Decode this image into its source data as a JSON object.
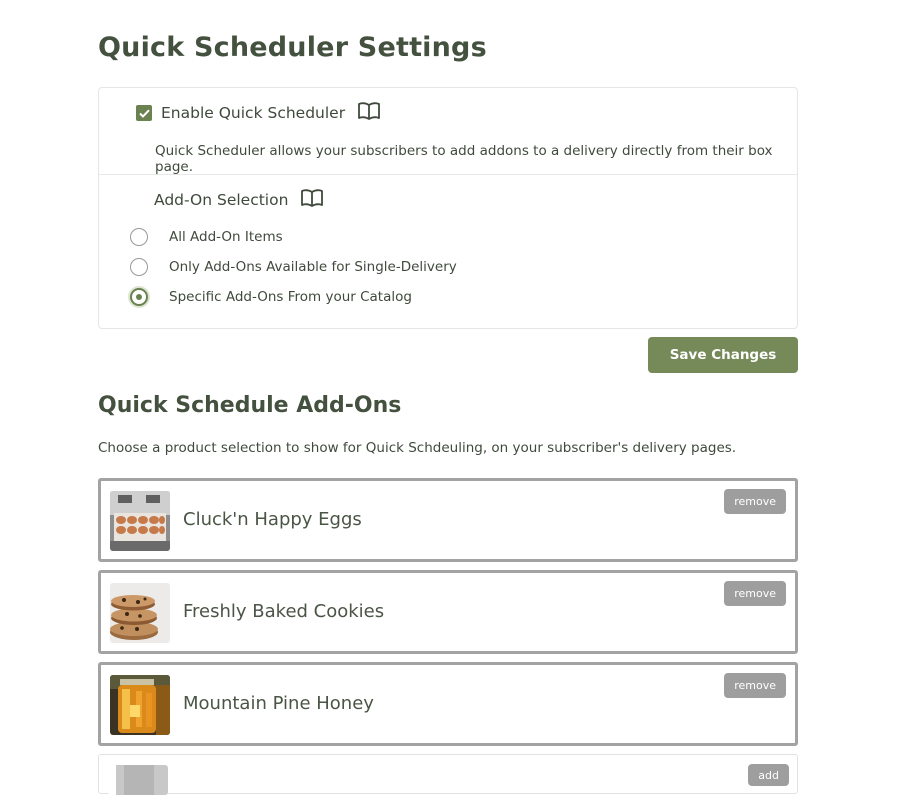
{
  "settings": {
    "title": "Quick Scheduler Settings",
    "enable_label": "Enable Quick Scheduler",
    "enable_checked": true,
    "enable_description": "Quick Scheduler allows your subscribers to add addons to a delivery directly from their box page.",
    "addon_selection_label": "Add-On Selection",
    "options": [
      {
        "label": "All Add-On Items",
        "selected": false
      },
      {
        "label": "Only Add-Ons Available for Single-Delivery",
        "selected": false
      },
      {
        "label": "Specific Add-Ons From your Catalog",
        "selected": true
      }
    ],
    "save_label": "Save Changes",
    "icon": "book-open-icon"
  },
  "addons": {
    "title": "Quick Schedule Add-Ons",
    "description": "Choose a product selection to show for Quick Schdeuling, on your subscriber's delivery pages.",
    "items": [
      {
        "name": "Cluck'n Happy Eggs",
        "action": "remove",
        "image": "eggs-thumbnail"
      },
      {
        "name": "Freshly Baked Cookies",
        "action": "remove",
        "image": "cookies-thumbnail"
      },
      {
        "name": "Mountain Pine Honey",
        "action": "remove",
        "image": "honey-thumbnail"
      }
    ],
    "next_item": {
      "action": "add"
    }
  },
  "colors": {
    "accent": "#6b8150",
    "button": "#758a58",
    "heading": "#44513f",
    "remove": "#9e9e9e"
  }
}
